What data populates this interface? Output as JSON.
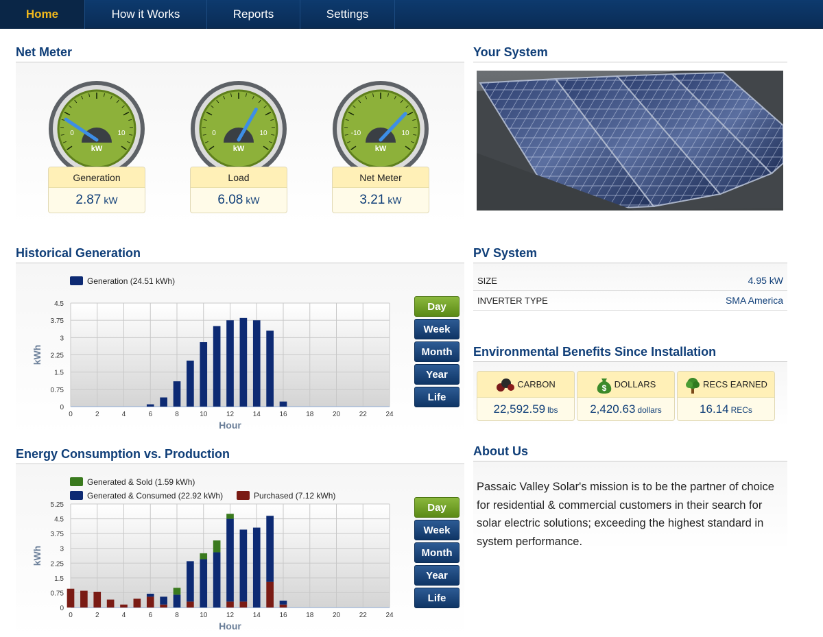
{
  "nav": {
    "tabs": [
      {
        "label": "Home",
        "active": true
      },
      {
        "label": "How it Works",
        "active": false
      },
      {
        "label": "Reports",
        "active": false
      },
      {
        "label": "Settings",
        "active": false
      }
    ]
  },
  "net_meter": {
    "title": "Net Meter",
    "gauges": [
      {
        "label": "Generation",
        "value": "2.87",
        "unit": "kW",
        "scale_min": "0",
        "scale_max": "10",
        "dial_unit": "kW"
      },
      {
        "label": "Load",
        "value": "6.08",
        "unit": "kW",
        "scale_min": "0",
        "scale_max": "10",
        "dial_unit": "kW"
      },
      {
        "label": "Net Meter",
        "value": "3.21",
        "unit": "kW",
        "scale_min": "-10",
        "scale_max": "10",
        "dial_unit": "kW"
      }
    ]
  },
  "your_system": {
    "title": "Your System"
  },
  "historical": {
    "title": "Historical Generation",
    "range_buttons": [
      "Day",
      "Week",
      "Month",
      "Year",
      "Life"
    ],
    "active_range": "Day"
  },
  "consumption": {
    "title": "Energy Consumption vs. Production",
    "range_buttons": [
      "Day",
      "Week",
      "Month",
      "Year",
      "Life"
    ],
    "active_range": "Day"
  },
  "pv_system": {
    "title": "PV System",
    "rows": [
      {
        "key": "SIZE",
        "value": "4.95 kW"
      },
      {
        "key": "INVERTER TYPE",
        "value": "SMA America"
      }
    ]
  },
  "env": {
    "title": "Environmental Benefits Since Installation",
    "cards": [
      {
        "label": "CARBON",
        "value": "22,592.59",
        "unit": "lbs",
        "icon": "carbon-molecule-icon"
      },
      {
        "label": "DOLLARS",
        "value": "2,420.63",
        "unit": "dollars",
        "icon": "money-bag-icon"
      },
      {
        "label": "RECS EARNED",
        "value": "16.14",
        "unit": "RECs",
        "icon": "tree-icon"
      }
    ]
  },
  "about": {
    "title": "About Us",
    "text": "Passaic Valley Solar's mission is to be the partner of choice for residential & commercial customers in their search for solar electric solutions; exceeding the highest standard in system performance."
  },
  "colors": {
    "brand_blue": "#0f3e78",
    "nav_active": "#f1b81c",
    "generation": "#0d2a73",
    "generated_sold": "#3a7a1e",
    "purchased": "#7a1b14",
    "button_active": "#6f9d21"
  },
  "chart_data": [
    {
      "type": "bar",
      "title": "",
      "xlabel": "Hour",
      "ylabel": "kWh",
      "ylim": [
        0,
        4.5
      ],
      "yticks": [
        "0",
        "0.75",
        "1.5",
        "2.25",
        "3",
        "3.75",
        "4.5"
      ],
      "xticks": [
        "0",
        "2",
        "4",
        "6",
        "8",
        "10",
        "12",
        "14",
        "16",
        "18",
        "20",
        "22",
        "24"
      ],
      "xlim": [
        0,
        24
      ],
      "grid": true,
      "legend": "top-left",
      "series": [
        {
          "name": "Generation (24.51 kWh)",
          "color": "#0d2a73",
          "x": [
            6,
            7,
            8,
            9,
            10,
            11,
            12,
            13,
            14,
            15,
            16
          ],
          "values": [
            0.1,
            0.4,
            1.1,
            2.0,
            2.8,
            3.5,
            3.75,
            3.85,
            3.75,
            3.3,
            0.22
          ]
        }
      ]
    },
    {
      "type": "bar",
      "stacked": true,
      "title": "",
      "xlabel": "Hour",
      "ylabel": "kWh",
      "ylim": [
        0,
        5.25
      ],
      "yticks": [
        "0",
        "0.75",
        "1.5",
        "2.25",
        "3",
        "3.75",
        "4.5",
        "5.25"
      ],
      "xticks": [
        "0",
        "2",
        "4",
        "6",
        "8",
        "10",
        "12",
        "14",
        "16",
        "18",
        "20",
        "22",
        "24"
      ],
      "xlim": [
        0,
        24
      ],
      "grid": true,
      "legend": "top-left",
      "x": [
        0,
        1,
        2,
        3,
        4,
        5,
        6,
        7,
        8,
        9,
        10,
        11,
        12,
        13,
        14,
        15,
        16
      ],
      "series": [
        {
          "name": "Purchased (7.12 kWh)",
          "color": "#7a1b14",
          "values": [
            0.95,
            0.85,
            0.8,
            0.4,
            0.15,
            0.45,
            0.55,
            0.15,
            0,
            0.3,
            0,
            0,
            0.3,
            0.3,
            0,
            1.3,
            0.15
          ]
        },
        {
          "name": "Generated & Consumed (22.92 kWh)",
          "color": "#0d2a73",
          "values": [
            0,
            0,
            0,
            0,
            0,
            0,
            0.15,
            0.4,
            0.65,
            2.05,
            2.45,
            2.8,
            4.2,
            3.65,
            4.05,
            3.35,
            0.2
          ]
        },
        {
          "name": "Generated & Sold (1.59 kWh)",
          "color": "#3a7a1e",
          "values": [
            0,
            0,
            0,
            0,
            0,
            0,
            0,
            0,
            0.35,
            0,
            0.3,
            0.6,
            0.25,
            0,
            0,
            0,
            0
          ]
        }
      ]
    }
  ]
}
